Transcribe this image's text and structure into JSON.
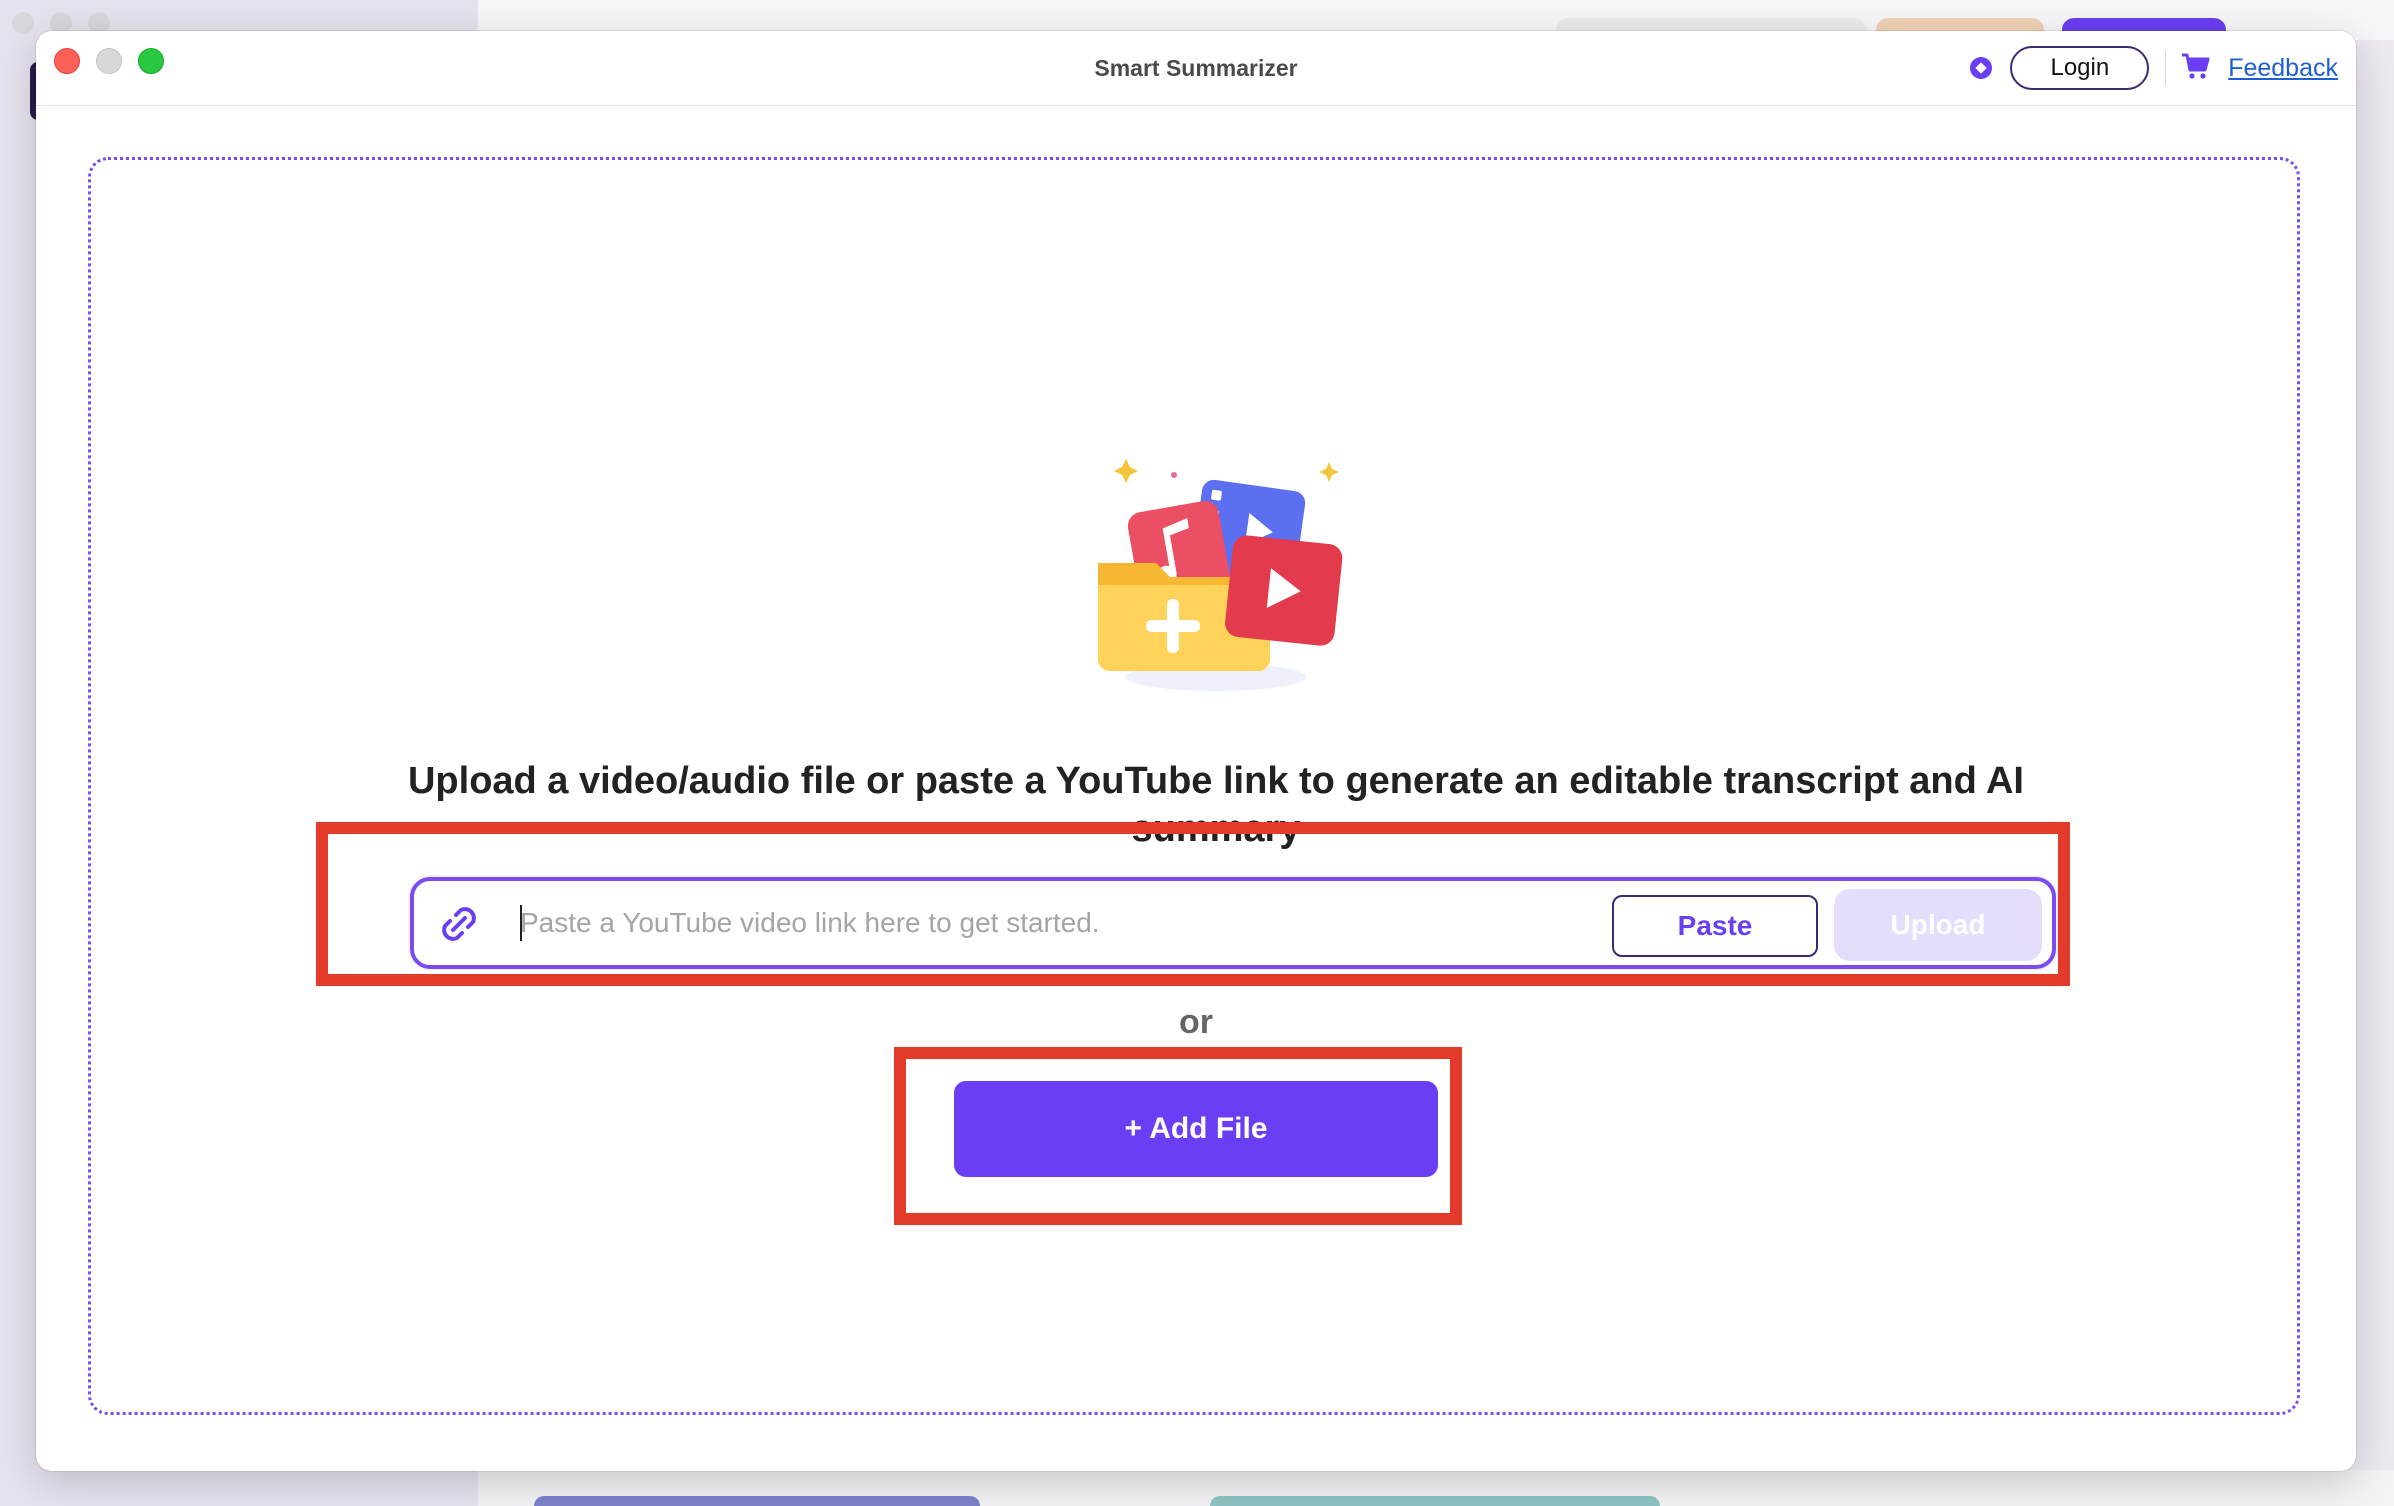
{
  "window": {
    "title": "Smart Summarizer"
  },
  "header": {
    "login_label": "Login",
    "feedback_label": "Feedback"
  },
  "main": {
    "headline": "Upload a video/audio file or paste a YouTube link to generate an editable transcript and AI summary",
    "link_input": {
      "value": "",
      "placeholder": "Paste a YouTube video link here to get started."
    },
    "paste_label": "Paste",
    "upload_label": "Upload",
    "or_label": "or",
    "add_file_label": "+ Add File"
  },
  "icons": {
    "premium": "diamond-icon",
    "cart": "cart-icon",
    "link": "link-icon",
    "illustration": "media-folder-illustration"
  },
  "colors": {
    "accent": "#6a3ef2",
    "highlight": "#e43a2a",
    "link": "#1f5fd6",
    "upload_disabled": "#e6dcfb"
  }
}
